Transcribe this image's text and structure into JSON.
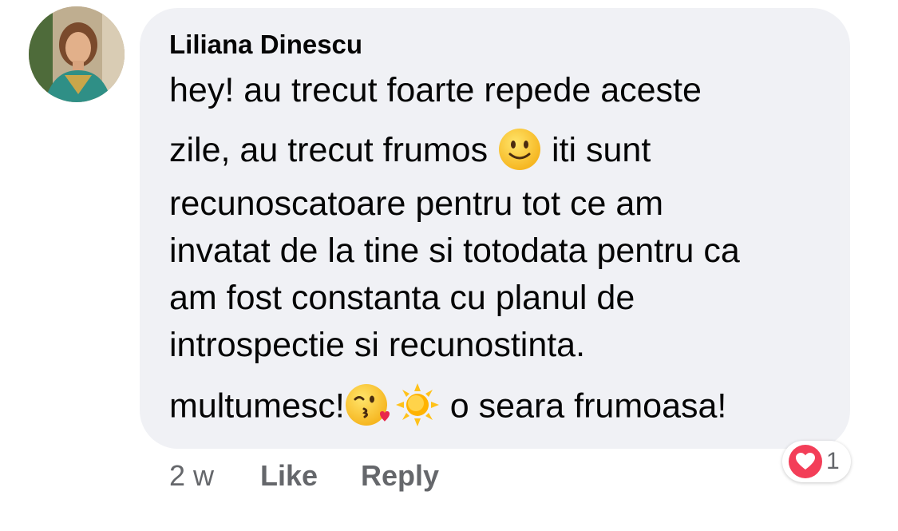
{
  "comment": {
    "author": "Liliana Dinescu",
    "lines": [
      "hey! au trecut foarte repede aceste",
      "zile, au trecut frumos",
      "iti sunt",
      "recunoscatoare pentru tot ce am",
      "invatat de la tine si totodata pentru ca",
      "am fost constanta cu planul de",
      "introspectie si recunostinta.",
      "multumesc!",
      "o seara frumoasa!"
    ],
    "emojis": [
      "slightly-smiling-face",
      "face-blowing-a-kiss",
      "sun"
    ]
  },
  "footer": {
    "time": "2 w",
    "like_label": "Like",
    "reply_label": "Reply"
  },
  "reaction": {
    "type": "love",
    "count": "1",
    "color": "#f33e58"
  },
  "colors": {
    "bubble": "#f0f1f5",
    "text": "#050505",
    "muted": "#65676b"
  }
}
